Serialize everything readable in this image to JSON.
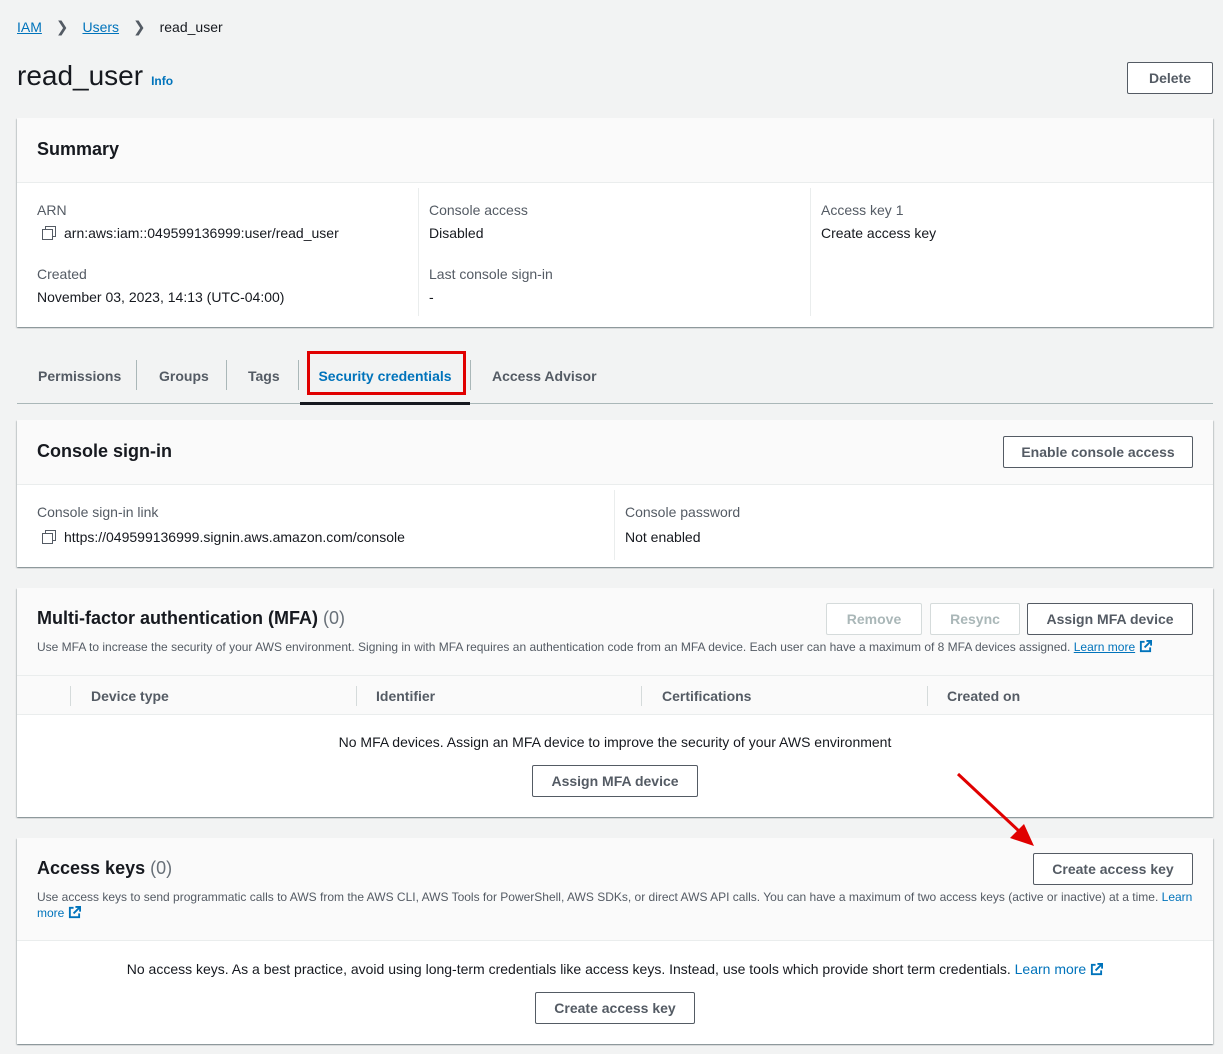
{
  "breadcrumb": {
    "root": "IAM",
    "parent": "Users",
    "current": "read_user"
  },
  "page": {
    "title": "read_user",
    "info": "Info",
    "delete_label": "Delete"
  },
  "summary": {
    "heading": "Summary",
    "arn_label": "ARN",
    "arn_value": "arn:aws:iam::049599136999:user/read_user",
    "created_label": "Created",
    "created_value": "November 03, 2023, 14:13 (UTC-04:00)",
    "console_access_label": "Console access",
    "console_access_value": "Disabled",
    "last_signin_label": "Last console sign-in",
    "last_signin_value": "-",
    "access_key_label": "Access key 1",
    "access_key_link": "Create access key"
  },
  "tabs": [
    {
      "label": "Permissions"
    },
    {
      "label": "Groups"
    },
    {
      "label": "Tags"
    },
    {
      "label": "Security credentials",
      "active": true
    },
    {
      "label": "Access Advisor"
    }
  ],
  "console_signin": {
    "heading": "Console sign-in",
    "enable_label": "Enable console access",
    "link_label": "Console sign-in link",
    "link_value": "https://049599136999.signin.aws.amazon.com/console",
    "password_label": "Console password",
    "password_value": "Not enabled"
  },
  "mfa": {
    "heading": "Multi-factor authentication (MFA)",
    "count": "(0)",
    "remove_label": "Remove",
    "resync_label": "Resync",
    "assign_label": "Assign MFA device",
    "description": "Use MFA to increase the security of your AWS environment. Signing in with MFA requires an authentication code from an MFA device. Each user can have a maximum of 8 MFA devices assigned.",
    "learn_more": "Learn more",
    "columns": [
      "Device type",
      "Identifier",
      "Certifications",
      "Created on"
    ],
    "empty_text": "No MFA devices. Assign an MFA device to improve the security of your AWS environment",
    "empty_button": "Assign MFA device"
  },
  "access_keys": {
    "heading": "Access keys",
    "count": "(0)",
    "create_label": "Create access key",
    "description": "Use access keys to send programmatic calls to AWS from the AWS CLI, AWS Tools for PowerShell, AWS SDKs, or direct AWS API calls. You can have a maximum of two access keys (active or inactive) at a time.",
    "learn_more": "Learn more",
    "empty_text": "No access keys. As a best practice, avoid using long-term credentials like access keys. Instead, use tools which provide short term credentials.",
    "empty_learn_more": "Learn more",
    "empty_button": "Create access key"
  },
  "colors": {
    "link": "#0073bb",
    "annotation": "#e00000",
    "active_tab_border": "#16191f"
  },
  "icons": {
    "copy": "copy-icon",
    "external": "external-link-icon",
    "chevron": "chevron-right-icon",
    "arrow": "annotation-arrow"
  }
}
